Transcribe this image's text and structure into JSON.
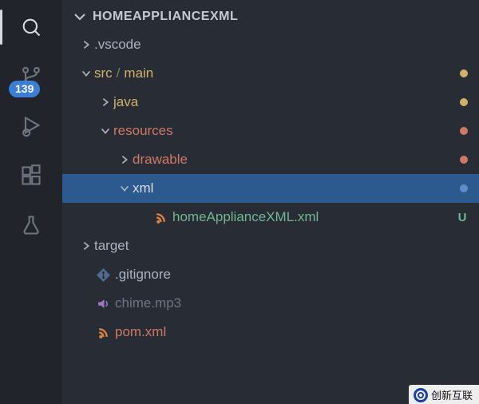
{
  "activity": {
    "scm_badge": "139"
  },
  "explorer": {
    "section_title": "HOMEAPPLIANCEXML",
    "rows": [
      {
        "id": "vscode",
        "indent": 1,
        "twisty": "right",
        "label": ".vscode",
        "color": "c-grey",
        "icon": null,
        "status": null
      },
      {
        "id": "src-main",
        "indent": 1,
        "twisty": "down",
        "label_parts": [
          "src",
          "main"
        ],
        "color": "c-yellow",
        "icon": null,
        "status": {
          "dot": "dot-yellow"
        }
      },
      {
        "id": "java",
        "indent": 2,
        "twisty": "right",
        "label": "java",
        "color": "c-yellow",
        "icon": null,
        "status": {
          "dot": "dot-yellow"
        }
      },
      {
        "id": "resources",
        "indent": 2,
        "twisty": "down",
        "label": "resources",
        "color": "c-red",
        "icon": null,
        "status": {
          "dot": "dot-red"
        }
      },
      {
        "id": "drawable",
        "indent": 3,
        "twisty": "right",
        "label": "drawable",
        "color": "c-red",
        "icon": null,
        "status": {
          "dot": "dot-red"
        }
      },
      {
        "id": "xml",
        "indent": 3,
        "twisty": "down",
        "label": "xml",
        "color": "c-white",
        "icon": null,
        "status": {
          "dot": "dot-blue"
        },
        "selected": true
      },
      {
        "id": "home-xml",
        "indent": 4,
        "twisty": null,
        "label": "homeApplianceXML.xml",
        "color": "c-green",
        "icon": "rss-orange",
        "status": {
          "letter": "U",
          "letter_color": "status-green"
        }
      },
      {
        "id": "target",
        "indent": 1,
        "twisty": "right",
        "label": "target",
        "color": "c-grey",
        "icon": null,
        "status": null
      },
      {
        "id": "gitignore",
        "indent": 1,
        "twisty": null,
        "label": ".gitignore",
        "color": "c-grey",
        "icon": "git",
        "status": null
      },
      {
        "id": "chime",
        "indent": 1,
        "twisty": null,
        "label": "chime.mp3",
        "color": "c-dim",
        "icon": "audio",
        "status": null
      },
      {
        "id": "pom",
        "indent": 1,
        "twisty": null,
        "label": "pom.xml",
        "color": "c-red",
        "icon": "rss-orange",
        "status": null
      }
    ]
  },
  "watermark": {
    "text": "创新互联"
  }
}
